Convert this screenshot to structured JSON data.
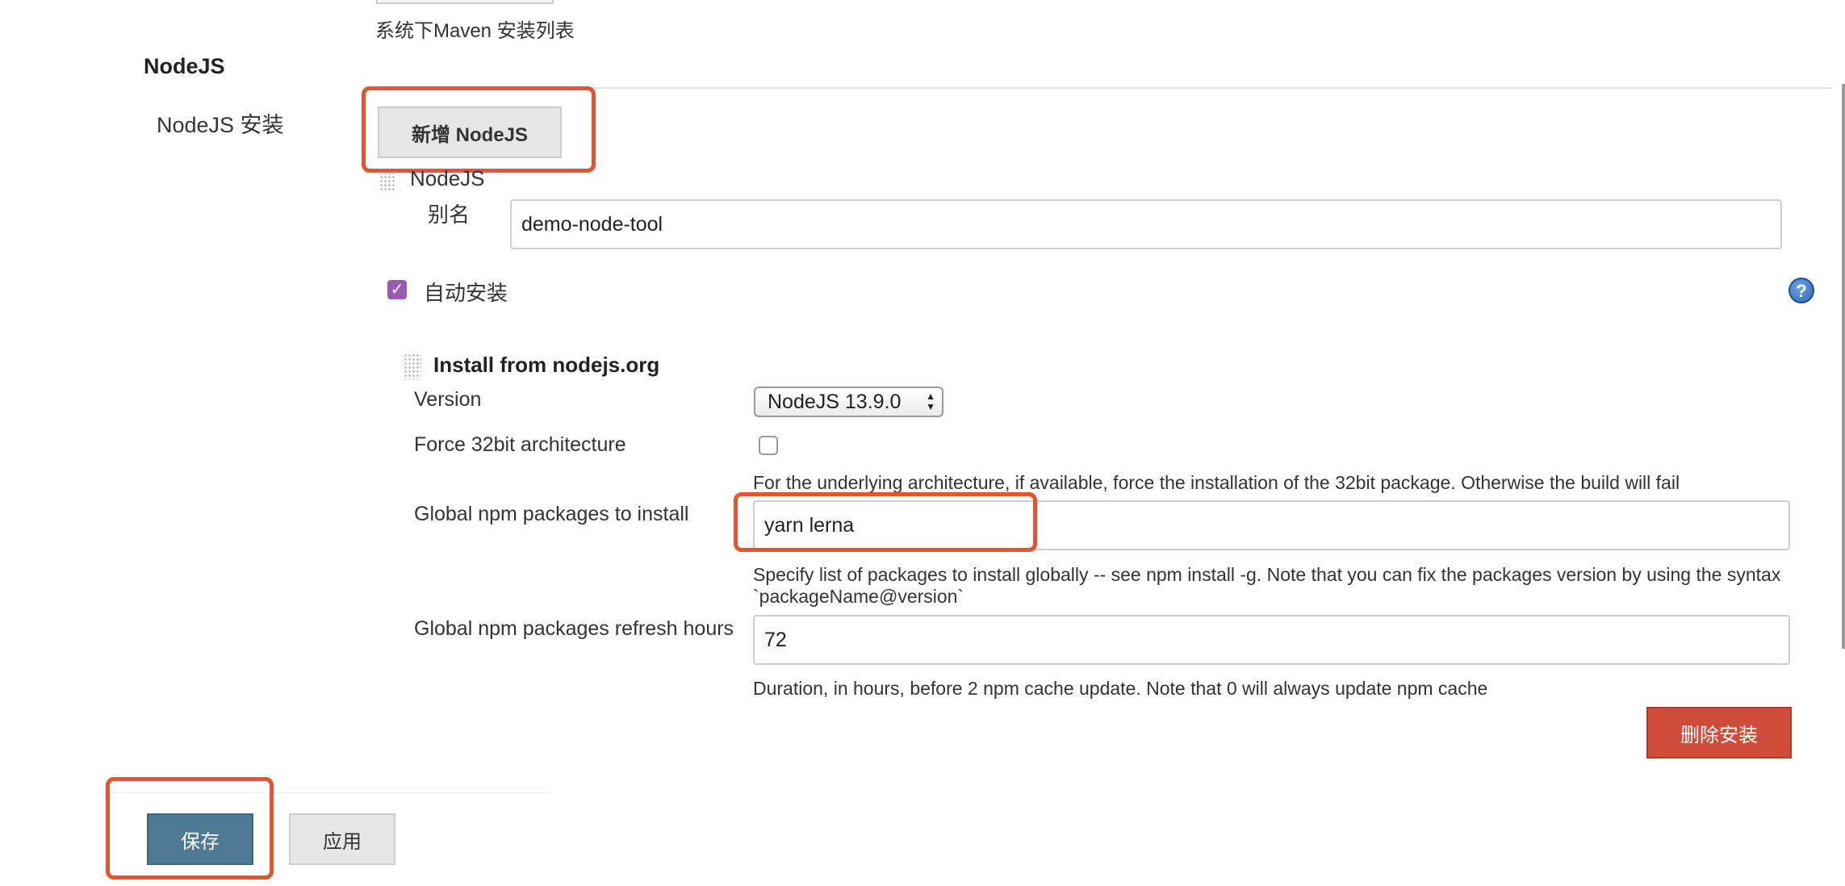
{
  "maven": {
    "description": "系统下Maven 安装列表"
  },
  "nodejs": {
    "section_title": "NodeJS",
    "install_label": "NodeJS 安装",
    "add_button": "新增 NodeJS",
    "item": {
      "heading": "NodeJS",
      "alias_label": "别名",
      "alias_value": "demo-node-tool",
      "auto_install_label": "自动安装",
      "auto_install_checked": true,
      "help_icon": "?",
      "installer": {
        "title": "Install from nodejs.org",
        "version_label": "Version",
        "version_value": "NodeJS 13.9.0",
        "force32_label": "Force 32bit architecture",
        "force32_checked": false,
        "force32_description": "For the underlying architecture, if available, force the installation of the 32bit package. Otherwise the build will fail",
        "global_packages_label": "Global npm packages to install",
        "global_packages_value": "yarn lerna",
        "global_packages_description": "Specify list of packages to install globally -- see npm install -g. Note that you can fix the packages version by using the syntax `packageName@version`",
        "refresh_label": "Global npm packages refresh hours",
        "refresh_value": "72",
        "refresh_description": "Duration, in hours, before 2 npm cache update. Note that 0 will always update npm cache"
      },
      "delete_button": "删除安装"
    }
  },
  "footer": {
    "save_button": "保存",
    "apply_button": "应用"
  },
  "colors": {
    "highlight": "#e8522c",
    "save_button": "#4f7a93",
    "delete_button": "#cf4b3a",
    "checkbox": "#9b59b6",
    "help_icon": "#2e67b8"
  }
}
